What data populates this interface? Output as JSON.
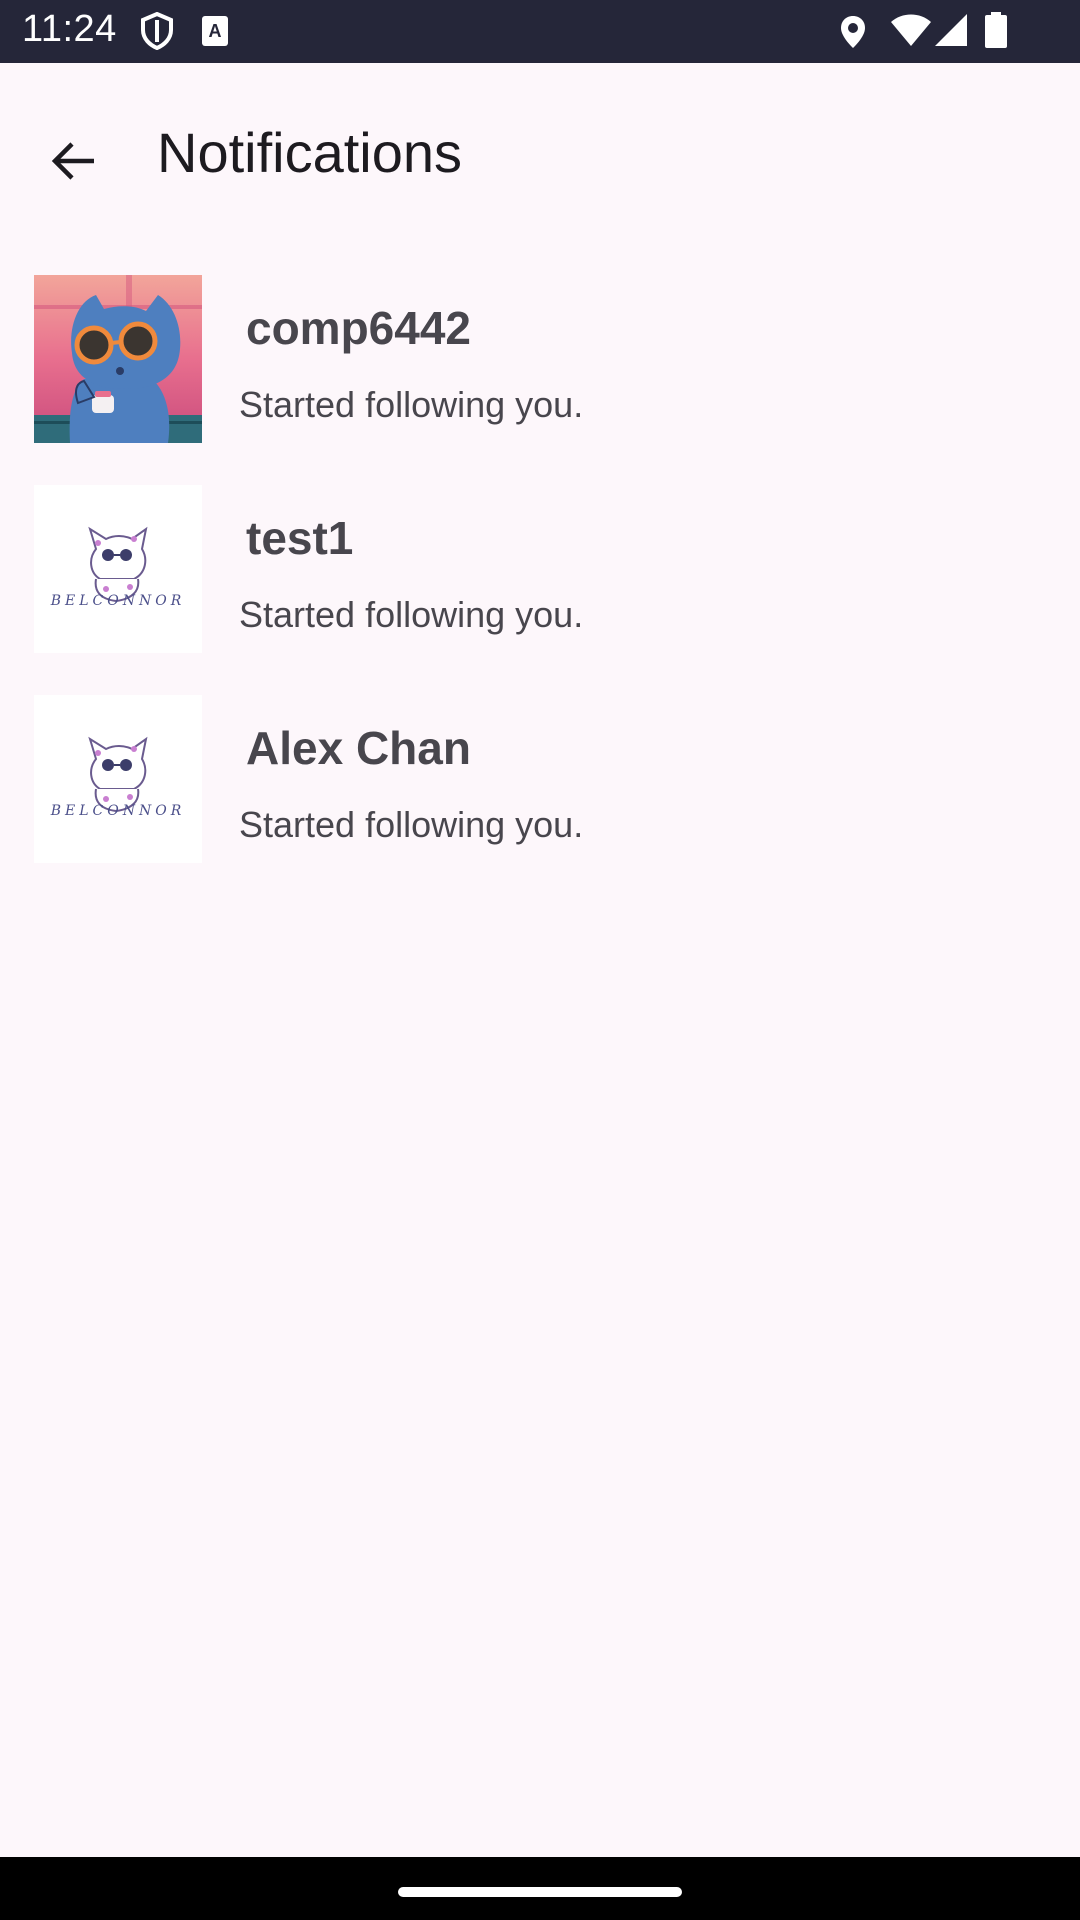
{
  "status_bar": {
    "time": "11:24",
    "icons_left": [
      "shield-icon",
      "font-a-icon"
    ],
    "icons_right": [
      "location-icon",
      "wifi-icon",
      "cell-signal-icon",
      "battery-icon"
    ]
  },
  "app_bar": {
    "back_icon": "arrow-back-icon",
    "title": "Notifications"
  },
  "notifications": [
    {
      "name": "comp6442",
      "message": "Started following you.",
      "avatar": "blue-cat-sunglasses"
    },
    {
      "name": "test1",
      "message": "Started following you.",
      "avatar": "belconnor-logo"
    },
    {
      "name": "Alex Chan",
      "message": "Started following you.",
      "avatar": "belconnor-logo"
    }
  ],
  "avatar_logo_text": "BELCONNOR",
  "colors": {
    "background": "#fdf7fb",
    "status_bar": "#252639",
    "text_primary": "#1d1b20",
    "text_secondary": "#48464d"
  }
}
